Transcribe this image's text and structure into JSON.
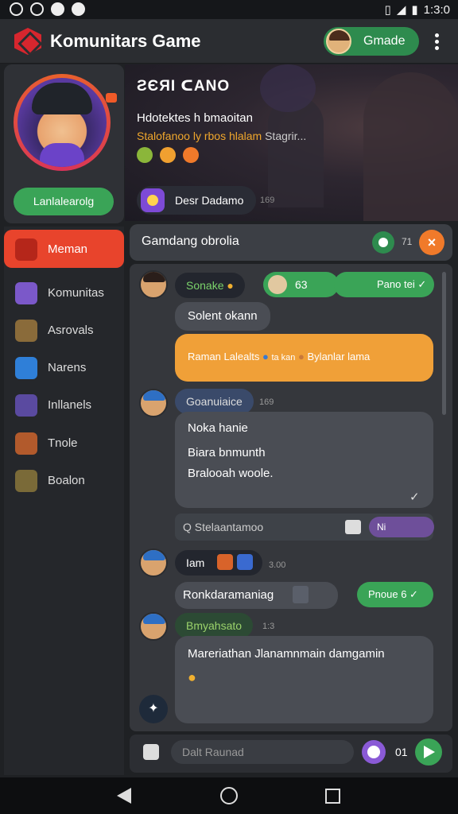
{
  "status": {
    "time": "1:3:0"
  },
  "appbar": {
    "title": "Komunitars Game",
    "game_button": "Gmade"
  },
  "banner": {
    "title": "ƧЄЯI ᑕANO",
    "subtitle": "Hdotektes h bmaoitan",
    "link": "Stalofanoo ly rbos hlalam",
    "link_extra": "Stagrir...",
    "desc_label": "Desr Dadamo",
    "desc_count": "169"
  },
  "profile": {
    "button": "Lanlalearolg"
  },
  "sidenav": {
    "items": [
      {
        "label": "Meman",
        "color": "#e8442c",
        "active": true
      },
      {
        "label": "Komunitas",
        "color": "#7b58c9"
      },
      {
        "label": "Asrovals",
        "color": "#8a6b3a"
      },
      {
        "label": "Narens",
        "color": "#2f7fd8"
      },
      {
        "label": "Inllanels",
        "color": "#5a4aa0"
      },
      {
        "label": "Tnole",
        "color": "#b25a2c"
      },
      {
        "label": "Boalon",
        "color": "#7a6a38"
      }
    ]
  },
  "chat": {
    "title": "Gamdang obrolia",
    "top_count": "71",
    "messages": {
      "m1_user": "Sonake",
      "m1_count": "63",
      "m1_reply": "Pano tei",
      "m1_text": "Solent okann",
      "m1_orange": "Raman Lalealts",
      "m1_orange_mid": "ta kan",
      "m1_orange_end": "Bylanlar lama",
      "m2_user": "Goanuiaice",
      "m2_time": "169",
      "m2_line1": "Noka hanie",
      "m2_line2": "Biara bnmunth",
      "m2_line3": "Bralooah woole.",
      "m2_search": "Q Stelaantamoo",
      "m2_search_count": "Ni",
      "m3_user": "Iam",
      "m3_time": "3.00",
      "m3_text": "Ronkdaramaniag",
      "m3_reply": "Pnoue 6",
      "m4_user": "Bmyahsato",
      "m4_time": "1:3",
      "m4_text": "Mareriathan Jlanamnmain damgamin"
    },
    "input_placeholder": "Dalt Raunad",
    "input_count": "01"
  }
}
